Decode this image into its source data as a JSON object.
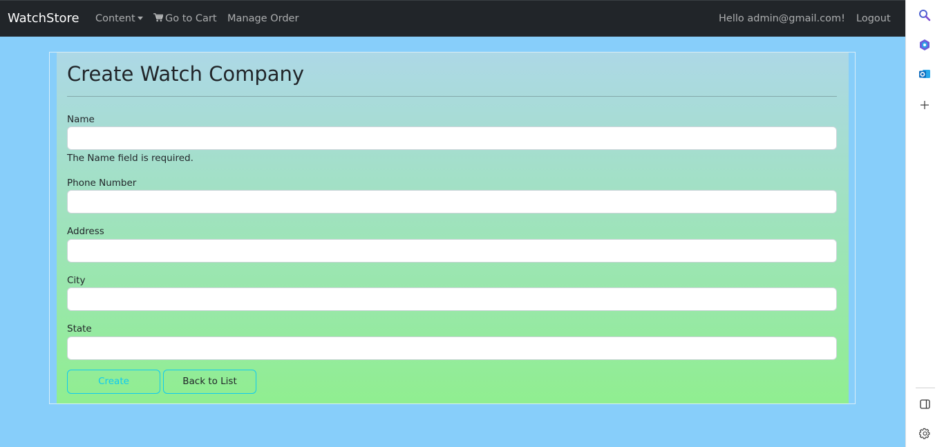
{
  "navbar": {
    "brand": "WatchStore",
    "content_menu": "Content",
    "cart_link": "Go to Cart",
    "manage_order_link": "Manage Order",
    "greeting": "Hello admin@gmail.com!",
    "logout_link": "Logout"
  },
  "form": {
    "title": "Create Watch Company",
    "fields": [
      {
        "label": "Name",
        "value": "",
        "placeholder": ""
      },
      {
        "label": "Phone Number",
        "value": "",
        "placeholder": ""
      },
      {
        "label": "Address",
        "value": "",
        "placeholder": ""
      },
      {
        "label": "City",
        "value": "",
        "placeholder": ""
      },
      {
        "label": "State",
        "value": "",
        "placeholder": ""
      }
    ],
    "name_error": "The Name field is required.",
    "create_button": "Create",
    "back_button": "Back to List"
  },
  "edge_sidebar": {
    "icons": [
      "search-icon",
      "copilot-icon",
      "outlook-icon",
      "plus-icon",
      "sidebar-toggle-icon",
      "settings-icon"
    ]
  },
  "colors": {
    "navbar_bg": "#212529",
    "page_bg": "#87cefa",
    "gradient_top": "#add8e6",
    "gradient_bottom": "#90ee90",
    "button_border": "#0dcaf0"
  }
}
